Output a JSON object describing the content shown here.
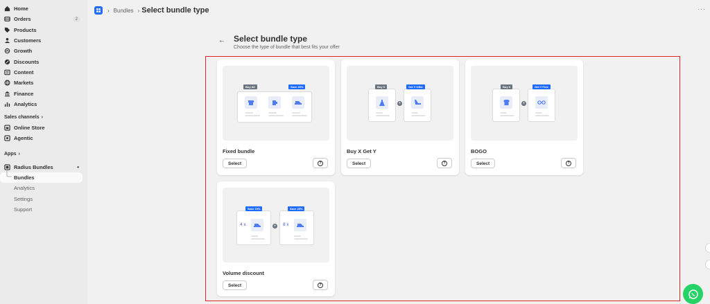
{
  "sidebar": {
    "items": [
      {
        "label": "Home",
        "icon": "home-icon"
      },
      {
        "label": "Orders",
        "icon": "orders-icon",
        "badge": "2"
      },
      {
        "label": "Products",
        "icon": "tag-icon"
      },
      {
        "label": "Customers",
        "icon": "person-icon"
      },
      {
        "label": "Growth",
        "icon": "growth-icon"
      },
      {
        "label": "Discounts",
        "icon": "discount-icon"
      },
      {
        "label": "Content",
        "icon": "content-icon"
      },
      {
        "label": "Markets",
        "icon": "globe-icon"
      },
      {
        "label": "Finance",
        "icon": "bank-icon"
      },
      {
        "label": "Analytics",
        "icon": "bar-chart-icon"
      }
    ],
    "sales_channels_label": "Sales channels",
    "channels": [
      {
        "label": "Online Store",
        "icon": "store-icon"
      },
      {
        "label": "Agentic",
        "icon": "agent-icon"
      }
    ],
    "apps_label": "Apps",
    "app_name": "Radius Bundles",
    "app_sub_items": [
      {
        "label": "Bundles",
        "active": true
      },
      {
        "label": "Analytics"
      },
      {
        "label": "Settings"
      },
      {
        "label": "Support"
      }
    ]
  },
  "topbar": {
    "crumb": "Bundles",
    "title": "Select bundle type"
  },
  "page": {
    "title": "Select bundle type",
    "subtitle": "Choose the type of bundle that best fits your offer"
  },
  "cards": [
    {
      "name": "Fixed bundle",
      "select_label": "Select",
      "tags": [
        "Buy All",
        "Save 20%"
      ]
    },
    {
      "name": "Buy X Get Y",
      "select_label": "Select",
      "tags": [
        "Buy X",
        "Get Y Offer"
      ]
    },
    {
      "name": "BOGO",
      "select_label": "Select",
      "tags": [
        "Buy X",
        "Get Y Free"
      ]
    },
    {
      "name": "Volume discount",
      "select_label": "Select",
      "tags": [
        "Save 15%",
        "Save 25%"
      ],
      "quantities": [
        "4 x",
        "8 x"
      ]
    }
  ],
  "colors": {
    "accent": "#1f6bff",
    "highlight_border": "#e02424",
    "whatsapp": "#25d366"
  }
}
